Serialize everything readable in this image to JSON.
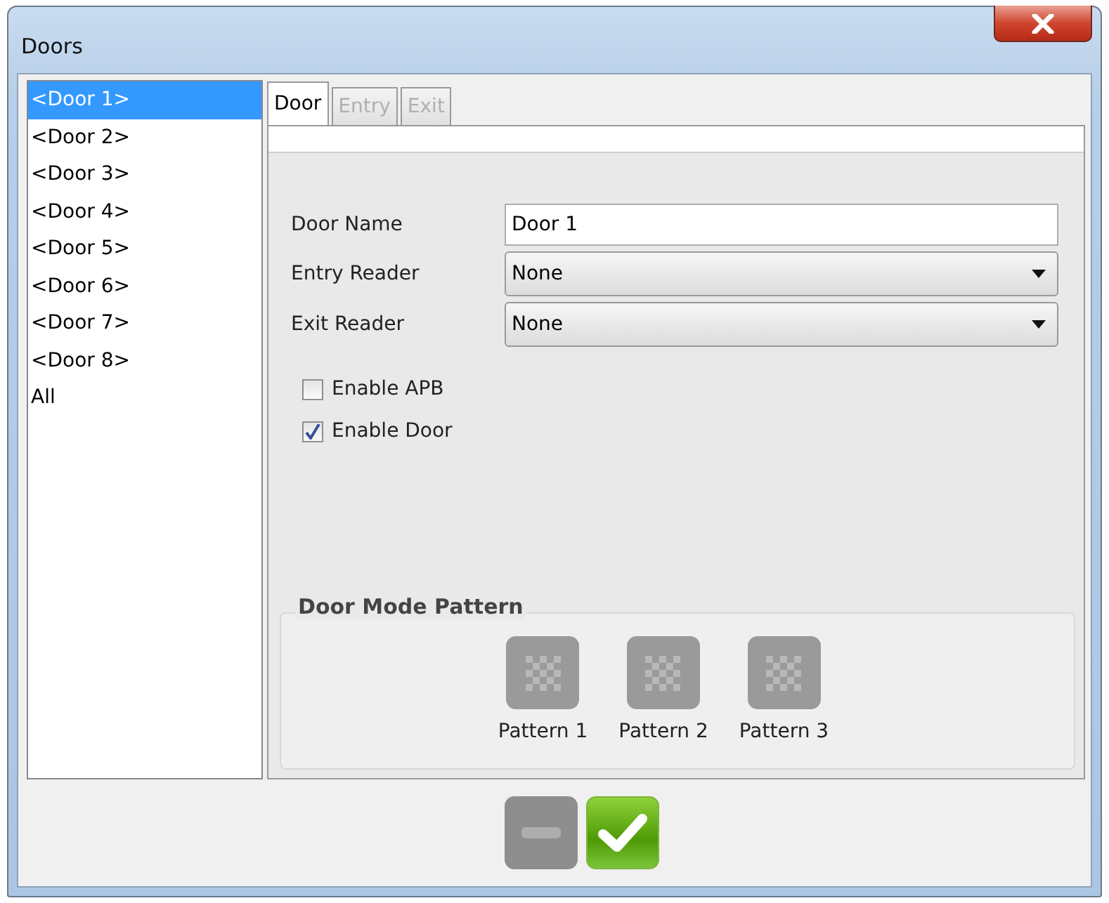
{
  "window": {
    "title": "Doors"
  },
  "doors": [
    {
      "label": "<Door 1>",
      "selected": true
    },
    {
      "label": "<Door 2>",
      "selected": false
    },
    {
      "label": "<Door 3>",
      "selected": false
    },
    {
      "label": "<Door 4>",
      "selected": false
    },
    {
      "label": "<Door 5>",
      "selected": false
    },
    {
      "label": "<Door 6>",
      "selected": false
    },
    {
      "label": "<Door 7>",
      "selected": false
    },
    {
      "label": "<Door 8>",
      "selected": false
    },
    {
      "label": "All",
      "selected": false
    }
  ],
  "tabs": [
    {
      "label": "Door",
      "selected": true,
      "disabled": false
    },
    {
      "label": "Entry",
      "selected": false,
      "disabled": true
    },
    {
      "label": "Exit",
      "selected": false,
      "disabled": true
    }
  ],
  "fields": [
    {
      "kind": "text",
      "label": "Door Name",
      "value": "Door 1"
    },
    {
      "kind": "select",
      "label": "Entry Reader",
      "value": "None"
    },
    {
      "kind": "select",
      "label": "Exit Reader",
      "value": "None"
    }
  ],
  "checkboxes": [
    {
      "label": "Enable APB",
      "checked": false
    },
    {
      "label": "Enable Door",
      "checked": true
    }
  ],
  "pattern_group": {
    "title": "Door Mode Pattern",
    "patterns": [
      {
        "label": "Pattern 1"
      },
      {
        "label": "Pattern 2"
      },
      {
        "label": "Pattern 3"
      }
    ]
  }
}
